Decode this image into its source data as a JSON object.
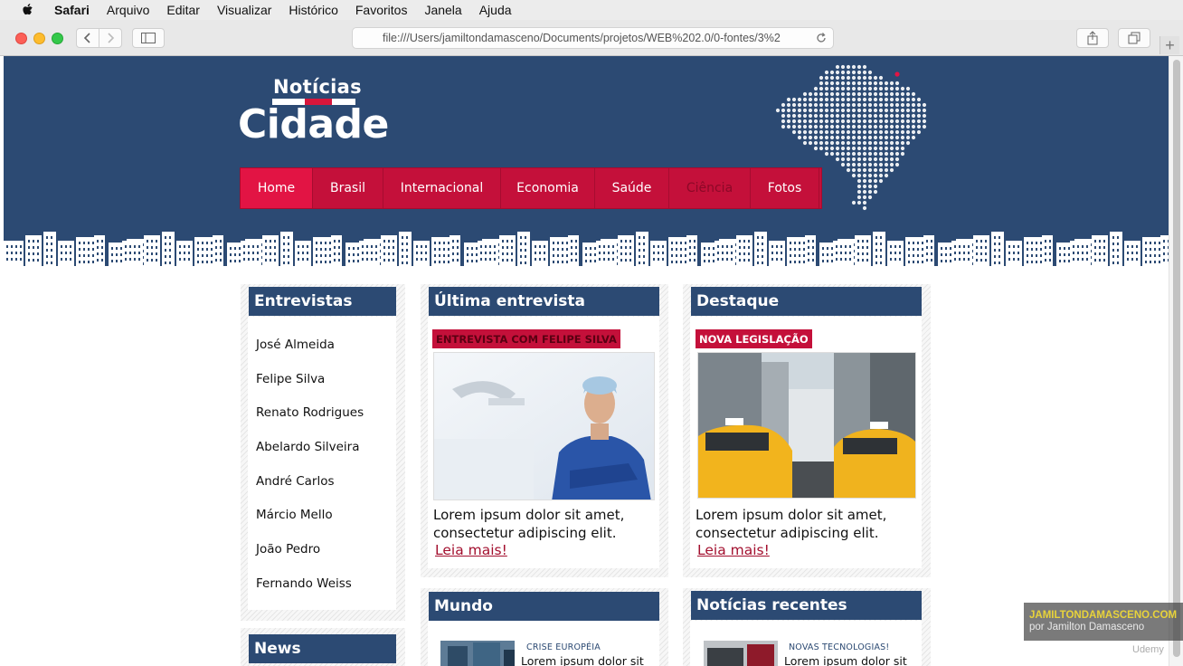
{
  "menubar": {
    "app": "Safari",
    "items": [
      "Arquivo",
      "Editar",
      "Visualizar",
      "Histórico",
      "Favoritos",
      "Janela",
      "Ajuda"
    ]
  },
  "browser": {
    "url": "file:///Users/jamiltondamasceno/Documents/projetos/WEB%202.0/0-fontes/3%2",
    "icons": [
      "back-icon",
      "forward-icon",
      "sidebar-icon",
      "reload-icon",
      "share-icon",
      "tabs-icon",
      "plus-icon"
    ],
    "plus": "+"
  },
  "site": {
    "logo_small": "Notícias",
    "logo_big": "Cidade",
    "colors": {
      "navy": "#2c4a73",
      "red": "#c4103a",
      "red_active": "#e21444"
    },
    "nav": [
      {
        "label": "Home",
        "state": "active"
      },
      {
        "label": "Brasil",
        "state": "normal"
      },
      {
        "label": "Internacional",
        "state": "normal"
      },
      {
        "label": "Economia",
        "state": "normal"
      },
      {
        "label": "Saúde",
        "state": "normal"
      },
      {
        "label": "Ciência",
        "state": "hover"
      },
      {
        "label": "Fotos",
        "state": "normal"
      }
    ]
  },
  "entrevistas": {
    "title": "Entrevistas",
    "items": [
      "José Almeida",
      "Felipe Silva",
      "Renato Rodrigues",
      "Abelardo Silveira",
      "André Carlos",
      "Márcio Mello",
      "João Pedro",
      "Fernando Weiss"
    ]
  },
  "news": {
    "title": "News"
  },
  "ultima": {
    "title": "Última entrevista",
    "tag": "ENTREVISTA COM FELIPE SILVA",
    "text": "Lorem ipsum dolor sit amet, consectetur adipiscing elit.",
    "link": "Leia mais!"
  },
  "destaque": {
    "title": "Destaque",
    "tag": "NOVA LEGISLAÇÃO",
    "text": "Lorem ipsum dolor sit amet, consectetur adipiscing elit.",
    "link": "Leia mais!"
  },
  "mundo": {
    "title": "Mundo",
    "category": "CRISE EUROPÉIA",
    "text": "Lorem ipsum dolor sit"
  },
  "recentes": {
    "title": "Notícias recentes",
    "category": "NOVAS TECNOLOGIAS!",
    "text": "Lorem ipsum dolor sit"
  },
  "watermark": {
    "line1": "JAMILTONDAMASCENO.COM",
    "line2": "por Jamilton Damasceno",
    "brand": "Udemy"
  }
}
